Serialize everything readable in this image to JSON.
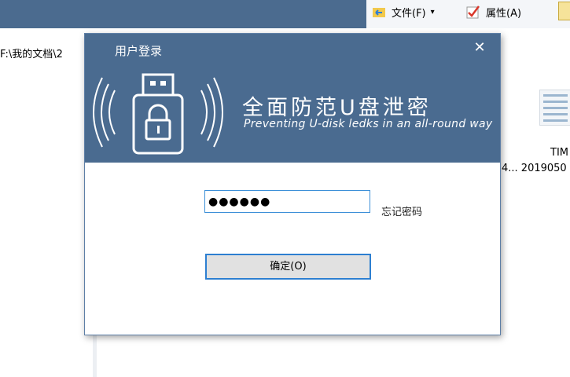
{
  "explorer": {
    "address_path": "F:\\我的文档\\2",
    "ribbon": [
      {
        "label": "文件(F)",
        "icon": "folder-move-icon"
      },
      {
        "label": "属性(A)",
        "icon": "checkmark-properties-icon"
      }
    ],
    "file_tile": {
      "label": "TIM",
      "name": "4...  2019050"
    }
  },
  "dialog": {
    "title": "用户登录",
    "slogan_cn": "全面防范U盘泄密",
    "slogan_en": "Preventing U-disk ledks in an all-round way",
    "password_masked": "●●●●●●",
    "forgot_label": "忘记密码",
    "ok_label": "确定(O)",
    "close_glyph": "✕"
  },
  "colors": {
    "banner": "#4a6b90",
    "titlebar": "#4b6b8f",
    "focus_border": "#2d7fd1"
  }
}
